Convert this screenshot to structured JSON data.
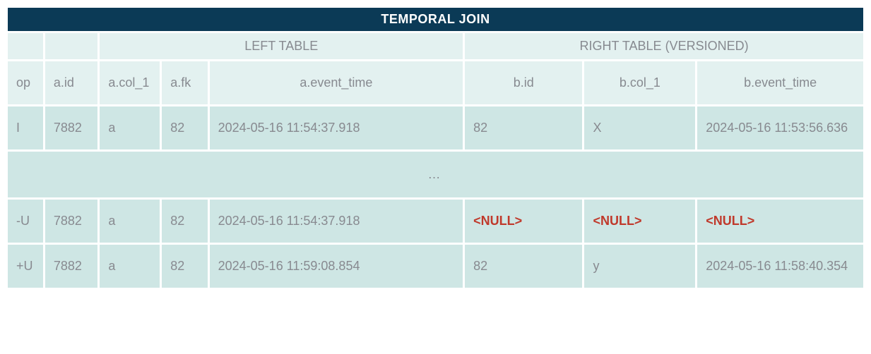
{
  "title": "TEMPORAL JOIN",
  "section_left": "LEFT TABLE",
  "section_right": "RIGHT TABLE (VERSIONED)",
  "headers": {
    "op": "op",
    "aid": "a.id",
    "acol": "a.col_1",
    "afk": "a.fk",
    "aet": "a.event_time",
    "bid": "b.id",
    "bcol": "b.col_1",
    "bet": "b.event_time"
  },
  "null_label": "<NULL>",
  "ellipsis": "…",
  "rows": [
    {
      "op": "I",
      "aid": "7882",
      "acol": "a",
      "afk": "82",
      "aet": "2024-05-16 11:54:37.918",
      "bid": "82",
      "bcol": "X",
      "bet": "2024-05-16 11:53:56.636",
      "bid_null": false,
      "bcol_null": false,
      "bet_null": false
    },
    {
      "op": "-U",
      "aid": "7882",
      "acol": "a",
      "afk": "82",
      "aet": "2024-05-16 11:54:37.918",
      "bid": "<NULL>",
      "bcol": "<NULL>",
      "bet": "<NULL>",
      "bid_null": true,
      "bcol_null": true,
      "bet_null": true
    },
    {
      "op": "+U",
      "aid": "7882",
      "acol": "a",
      "afk": "82",
      "aet": "2024-05-16 11:59:08.854",
      "bid": "82",
      "bcol": "y",
      "bet": "2024-05-16 11:58:40.354",
      "bid_null": false,
      "bcol_null": false,
      "bet_null": false
    }
  ]
}
